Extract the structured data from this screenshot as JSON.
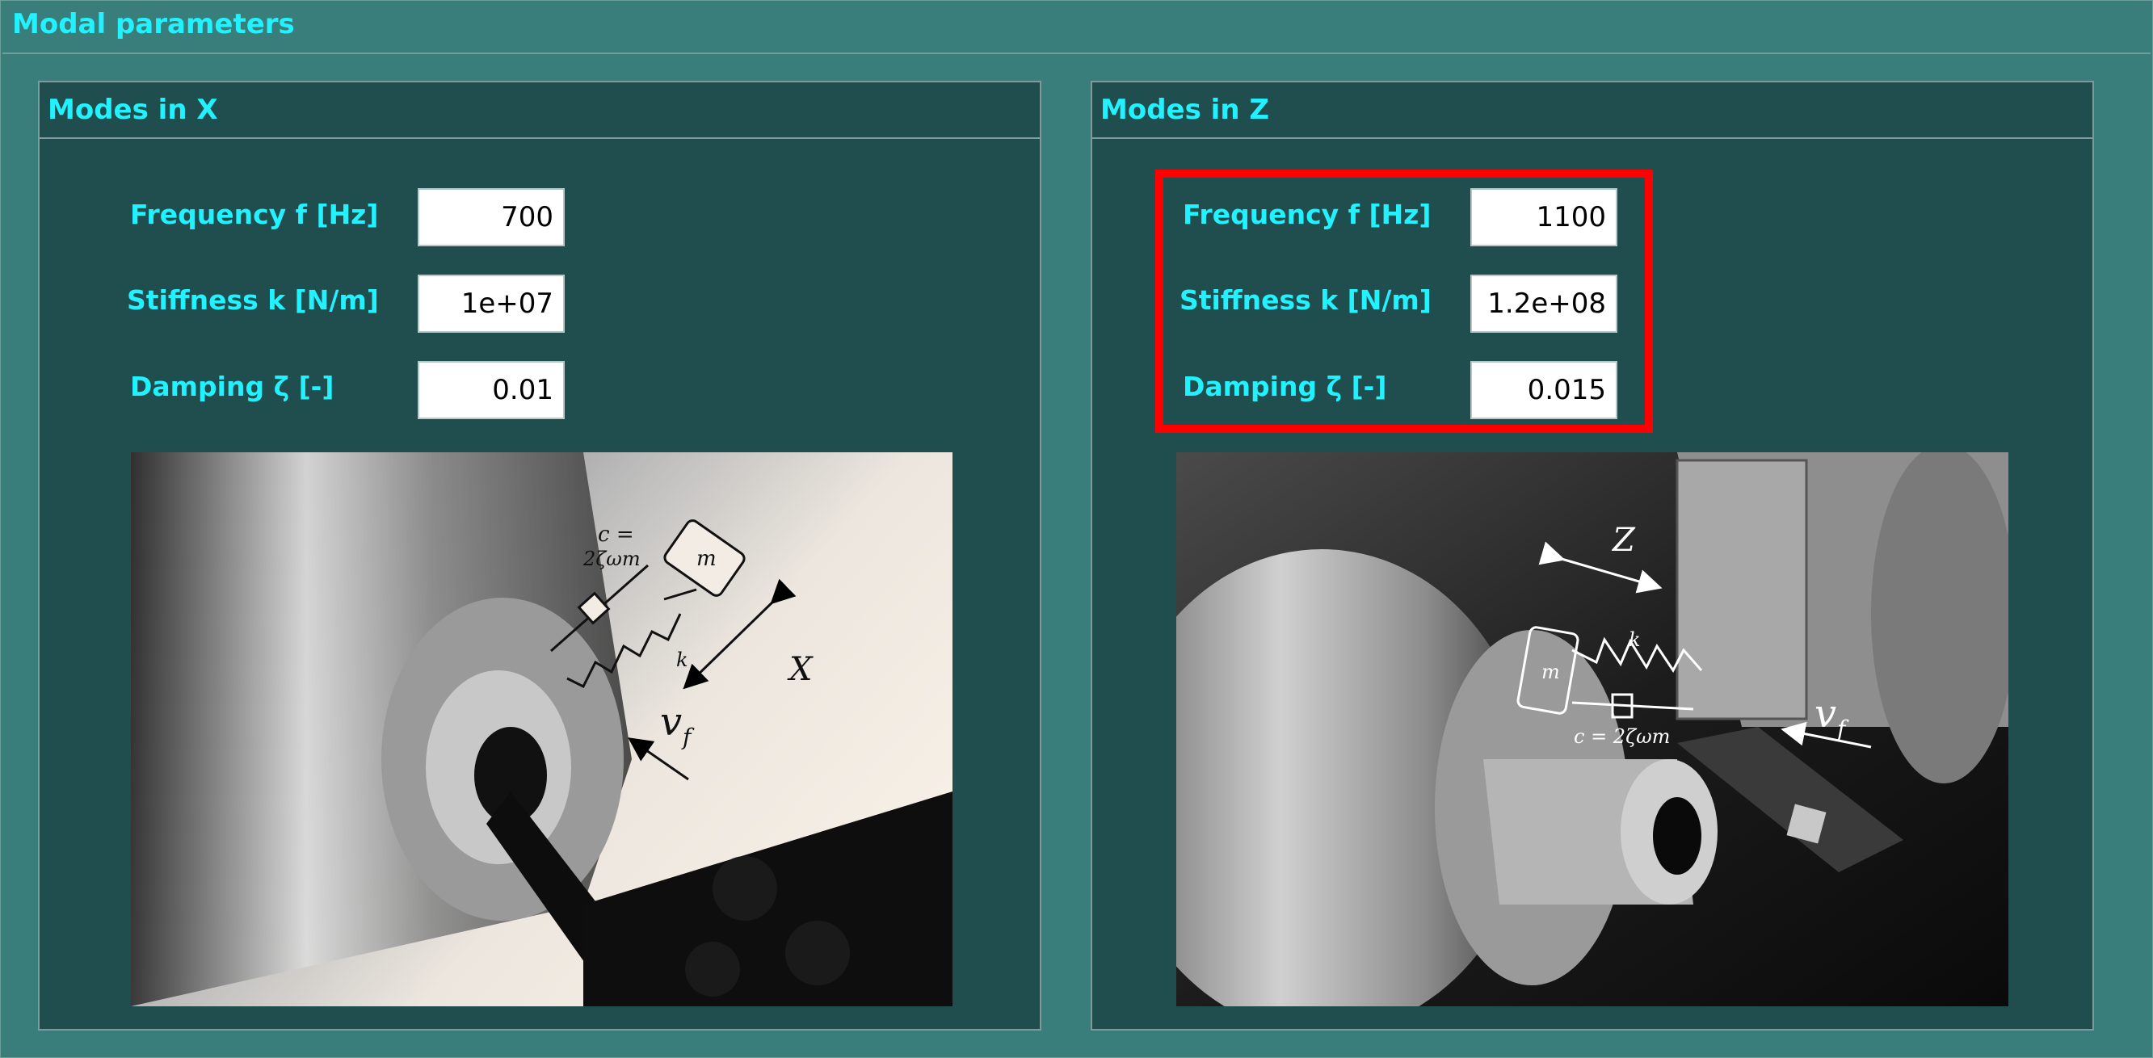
{
  "window": {
    "title": "Modal parameters"
  },
  "modes_x": {
    "title": "Modes in X",
    "frequency": {
      "label": "Frequency f [Hz]",
      "value": "700"
    },
    "stiffness": {
      "label": "Stiffness k [N/m]",
      "value": "1e+07"
    },
    "damping": {
      "label": "Damping ζ [-]",
      "value": "0.01"
    },
    "diagram": {
      "damper_label_1": "c =",
      "damper_label_2": "2ζωm",
      "mass_label": "m",
      "spring_label": "k",
      "axis_label": "X",
      "feed_label": "v",
      "feed_sub": "f"
    }
  },
  "modes_z": {
    "title": "Modes in Z",
    "frequency": {
      "label": "Frequency f [Hz]",
      "value": "1100"
    },
    "stiffness": {
      "label": "Stiffness k [N/m]",
      "value": "1.2e+08"
    },
    "damping": {
      "label": "Damping ζ [-]",
      "value": "0.015"
    },
    "diagram": {
      "damper_label": "c = 2ζωm",
      "mass_label": "m",
      "spring_label": "k",
      "axis_label": "Z",
      "feed_label": "v",
      "feed_sub": "f"
    }
  },
  "colors": {
    "background": "#3a7e7c",
    "panel": "#204e4e",
    "label": "#22f2ff",
    "highlight": "#ff0000"
  }
}
